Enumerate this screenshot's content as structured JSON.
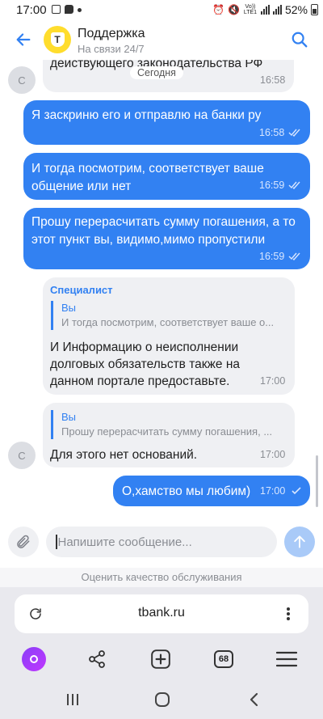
{
  "status_bar": {
    "time": "17:00",
    "volte": "Vo)) LTE1",
    "battery": "52%"
  },
  "header": {
    "logo_letter": "T",
    "title": "Поддержка",
    "subtitle": "На связи 24/7"
  },
  "messages": {
    "first": {
      "text": "действующего законодательства РФ",
      "time": "16:58",
      "avatar": "С"
    },
    "date_separator": "Сегодня",
    "m1": {
      "text": "Я заскриню его и отправлю на банки ру",
      "time": "16:58"
    },
    "m2": {
      "line1": "И тогда посмотрим, соответствует ваше",
      "line2": "общение или нет",
      "time": "16:59"
    },
    "m3": {
      "line1": "Прошу перерасчитать сумму погашения, а то",
      "line2": "этот пункт вы, видимо,мимо пропустили",
      "time": "16:59"
    },
    "m4": {
      "sender": "Специалист",
      "quote_author": "Вы",
      "quote_text": "И тогда посмотрим, соответствует ваше о...",
      "line1": "И Информацию о неисполнении",
      "line2": "долговых обязательств также на",
      "line3": "данном портале предоставьте.",
      "time": "17:00"
    },
    "m5": {
      "quote_author": "Вы",
      "quote_text": "Прошу перерасчитать сумму погашения, ...",
      "text": "Для этого нет оснований.",
      "time": "17:00",
      "avatar": "С"
    },
    "m6": {
      "text": "О,хамство мы любим)",
      "time": "17:00"
    }
  },
  "composer": {
    "placeholder": "Напишите сообщение...",
    "rate_link": "Оценить качество обслуживания"
  },
  "browser": {
    "url": "tbank.ru",
    "tabs_count": "68"
  },
  "colors": {
    "accent": "#3281f2",
    "incoming_bubble": "#eff0f3",
    "brand_yellow": "#ffdd2d"
  }
}
